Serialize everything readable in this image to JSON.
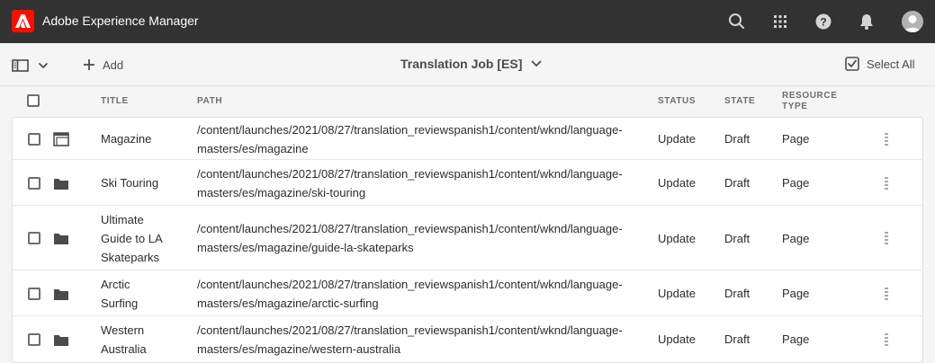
{
  "app": {
    "title": "Adobe Experience Manager",
    "logo_letter": "A"
  },
  "topbar": {
    "icons": [
      "search-icon",
      "apps-grid-icon",
      "help-icon",
      "bell-icon",
      "avatar"
    ]
  },
  "actionbar": {
    "add_label": "Add",
    "job_title": "Translation Job [ES]",
    "select_all_label": "Select All"
  },
  "table": {
    "columns": {
      "title": "TITLE",
      "path": "PATH",
      "status": "STATUS",
      "state": "STATE",
      "resource_type_1": "RESOURCE",
      "resource_type_2": "TYPE"
    },
    "rows": [
      {
        "icon": "page-icon",
        "title": [
          "Magazine"
        ],
        "path": [
          "/content/launches/2021/08/27/translation_reviewspanish1/content/wknd/language-",
          "masters/es/magazine"
        ],
        "status": "Update",
        "state": "Draft",
        "type": "Page"
      },
      {
        "icon": "folder-icon",
        "title": [
          "Ski Touring"
        ],
        "path": [
          "/content/launches/2021/08/27/translation_reviewspanish1/content/wknd/language-",
          "masters/es/magazine/ski-touring"
        ],
        "status": "Update",
        "state": "Draft",
        "type": "Page"
      },
      {
        "icon": "folder-icon",
        "title": [
          "Ultimate",
          "Guide to LA",
          "Skateparks"
        ],
        "path": [
          "/content/launches/2021/08/27/translation_reviewspanish1/content/wknd/language-",
          "masters/es/magazine/guide-la-skateparks"
        ],
        "status": "Update",
        "state": "Draft",
        "type": "Page"
      },
      {
        "icon": "folder-icon",
        "title": [
          "Arctic",
          "Surfing"
        ],
        "path": [
          "/content/launches/2021/08/27/translation_reviewspanish1/content/wknd/language-",
          "masters/es/magazine/arctic-surfing"
        ],
        "status": "Update",
        "state": "Draft",
        "type": "Page"
      },
      {
        "icon": "folder-icon",
        "title": [
          "Western",
          "Australia"
        ],
        "path": [
          "/content/launches/2021/08/27/translation_reviewspanish1/content/wknd/language-",
          "masters/es/magazine/western-australia"
        ],
        "status": "Update",
        "state": "Draft",
        "type": "Page"
      }
    ]
  },
  "colors": {
    "topbar": "#323232",
    "brand": "#fa0f00",
    "background": "#f5f5f5"
  }
}
